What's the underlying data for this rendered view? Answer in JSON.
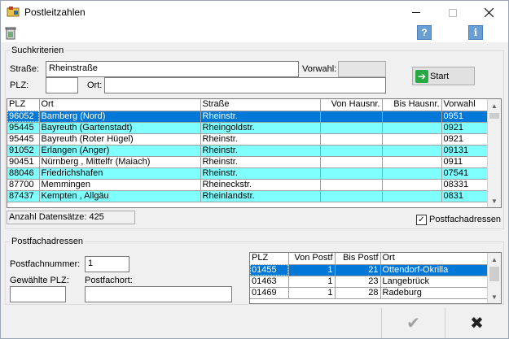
{
  "window": {
    "title": "Postleitzahlen"
  },
  "colors": {
    "selection": "#0078d7",
    "row_highlight": "#80ffff",
    "start_icon": "#2aa843"
  },
  "search": {
    "group_label": "Suchkriterien",
    "strasse_label": "Straße:",
    "strasse_value": "Rheinstraße",
    "vorwahl_label": "Vorwahl:",
    "vorwahl_value": "",
    "plz_label": "PLZ:",
    "plz_value": "",
    "ort_label": "Ort:",
    "ort_value": "",
    "start_label": "Start"
  },
  "results": {
    "columns": [
      "PLZ",
      "Ort",
      "Straße",
      "Von Hausnr.",
      "Bis Hausnr.",
      "Vorwahl"
    ],
    "rows": [
      {
        "plz": "96052",
        "ort": "Bamberg  (Nord)",
        "strasse": "Rheinstr.",
        "von": "",
        "bis": "",
        "vorwahl": "0951",
        "state": "selected"
      },
      {
        "plz": "95445",
        "ort": "Bayreuth  (Gartenstadt)",
        "strasse": "Rheingoldstr.",
        "von": "",
        "bis": "",
        "vorwahl": "0921",
        "state": "cyan"
      },
      {
        "plz": "95445",
        "ort": "Bayreuth  (Roter Hügel)",
        "strasse": "Rheinstr.",
        "von": "",
        "bis": "",
        "vorwahl": "0921",
        "state": "white"
      },
      {
        "plz": "91052",
        "ort": "Erlangen  (Anger)",
        "strasse": "Rheinstr.",
        "von": "",
        "bis": "",
        "vorwahl": "09131",
        "state": "cyan"
      },
      {
        "plz": "90451",
        "ort": "Nürnberg , Mittelfr (Maiach)",
        "strasse": "Rheinstr.",
        "von": "",
        "bis": "",
        "vorwahl": "0911",
        "state": "white"
      },
      {
        "plz": "88046",
        "ort": "Friedrichshafen",
        "strasse": "Rheinstr.",
        "von": "",
        "bis": "",
        "vorwahl": "07541",
        "state": "cyan"
      },
      {
        "plz": "87700",
        "ort": "Memmingen",
        "strasse": "Rheineckstr.",
        "von": "",
        "bis": "",
        "vorwahl": "08331",
        "state": "white"
      },
      {
        "plz": "87437",
        "ort": "Kempten , Allgäu",
        "strasse": "Rheinlandstr.",
        "von": "",
        "bis": "",
        "vorwahl": "0831",
        "state": "cyan"
      }
    ],
    "count_text": "Anzahl Datensätze: 425",
    "postfach_checkbox_label": "Postfachadressen",
    "postfach_checked": true
  },
  "postfach": {
    "group_label": "Postfachadressen",
    "nummer_label": "Postfachnummer:",
    "nummer_value": "1",
    "plz_label": "Gewählte PLZ:",
    "plz_value": "",
    "ort_label": "Postfachort:",
    "ort_value": "",
    "columns": [
      "PLZ",
      "Von Postf",
      "Bis Postf",
      "Ort"
    ],
    "rows": [
      {
        "plz": "01455",
        "von": "1",
        "bis": "21",
        "ort": "Ottendorf-Okrilla",
        "state": "selected"
      },
      {
        "plz": "01463",
        "von": "1",
        "bis": "23",
        "ort": "Langebrück",
        "state": "white"
      },
      {
        "plz": "01469",
        "von": "1",
        "bis": "28",
        "ort": "Radeburg",
        "state": "white"
      }
    ]
  },
  "buttons": {
    "ok_symbol": "✔",
    "cancel_symbol": "✖"
  }
}
